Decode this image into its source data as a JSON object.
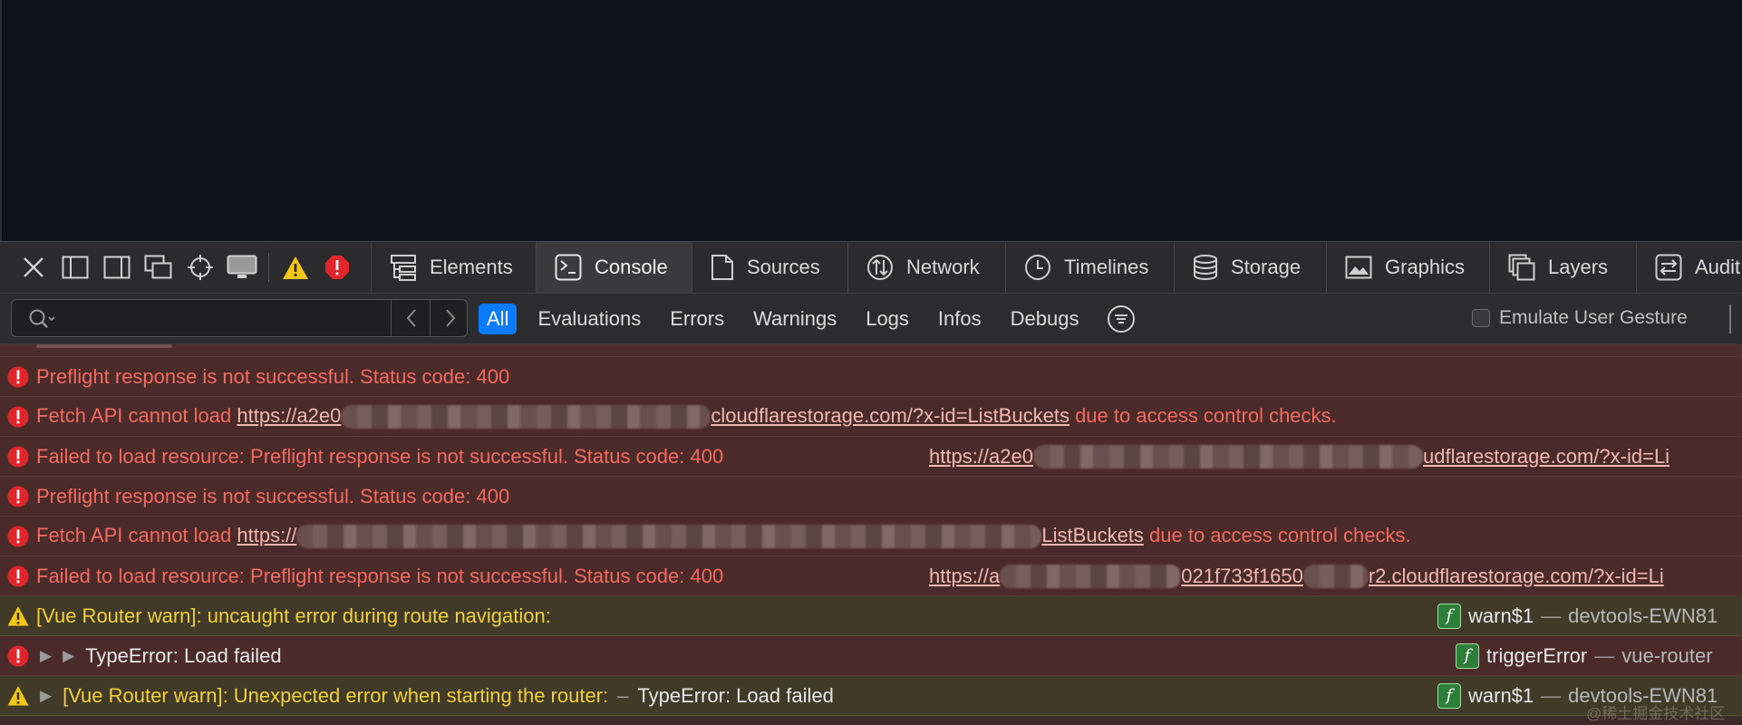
{
  "tabbar": {
    "tabs": [
      {
        "label": "Elements",
        "icon": "elements-icon"
      },
      {
        "label": "Console",
        "icon": "console-icon",
        "active": true
      },
      {
        "label": "Sources",
        "icon": "sources-icon"
      },
      {
        "label": "Network",
        "icon": "network-icon"
      },
      {
        "label": "Timelines",
        "icon": "timelines-icon"
      },
      {
        "label": "Storage",
        "icon": "storage-icon"
      },
      {
        "label": "Graphics",
        "icon": "graphics-icon"
      },
      {
        "label": "Layers",
        "icon": "layers-icon"
      },
      {
        "label": "Audit",
        "icon": "audit-icon"
      }
    ]
  },
  "filter": {
    "placeholder": "",
    "levels": [
      "All",
      "Evaluations",
      "Errors",
      "Warnings",
      "Logs",
      "Infos",
      "Debugs"
    ],
    "active_level": "All",
    "emulate_label": "Emulate User Gesture",
    "emulate_checked": false
  },
  "messages": {
    "m1": {
      "text": "Preflight response is not successful. Status code: 400"
    },
    "m2": {
      "prefix": "Fetch API cannot load ",
      "link_start": "https://a2e0",
      "link_end": "cloudflarestorage.com/?x-id=ListBuckets",
      "suffix": " due to access control checks."
    },
    "m3": {
      "text": "Failed to load resource: Preflight response is not successful. Status code: 400",
      "link_start": "https://a2e0",
      "link_end": "udflarestorage.com/?x-id=Li"
    },
    "m4": {
      "text": "Preflight response is not successful. Status code: 400"
    },
    "m5": {
      "prefix": "Fetch API cannot load ",
      "link_start": "https://",
      "link_end": "ListBuckets",
      "suffix": " due to access control checks."
    },
    "m6": {
      "text": "Failed to load resource: Preflight response is not successful. Status code: 400",
      "link_start": "https://a",
      "link_mid": "021f733f1650",
      "link_end": "r2.cloudflarestorage.com/?x-id=Li"
    },
    "m7": {
      "text": "[Vue Router warn]: uncaught error during route navigation:",
      "func": "warn$1",
      "sep": "—",
      "source": "devtools-EWN81"
    },
    "m8": {
      "text": "TypeError: Load failed",
      "func": "triggerError",
      "sep": "—",
      "source": "vue-router"
    },
    "m9": {
      "text": "[Vue Router warn]: Unexpected error when starting the router:",
      "dash": "–",
      "text2": "TypeError: Load failed",
      "func": "warn$1",
      "sep": "—",
      "source": "devtools-EWN81"
    }
  },
  "watermark": "@稀土掘金技术社区",
  "colors": {
    "accent": "#0a7aff",
    "error": "#f26a60",
    "warn": "#f0d13a",
    "error_bg": "#4a2b2a",
    "warn_bg": "#413a28"
  }
}
